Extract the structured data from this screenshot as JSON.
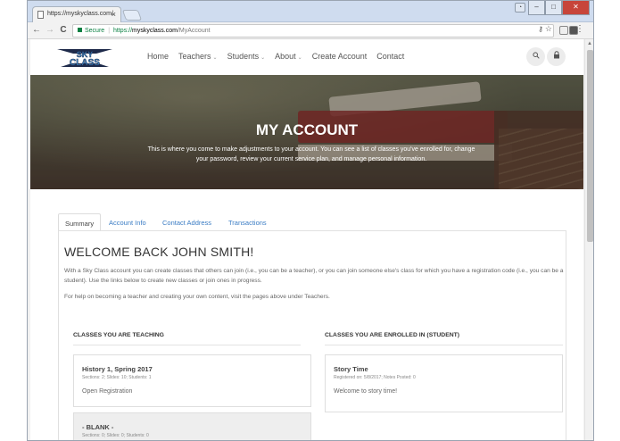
{
  "browser": {
    "tab_title": "https://myskyclass.com/",
    "tab_close": "×",
    "secure_label": "Secure",
    "url_scheme": "https://",
    "url_host": "myskyclass.com",
    "url_path": "/MyAccount",
    "back": "←",
    "forward": "→",
    "reload": "C",
    "home": "⌂",
    "star": "☆",
    "key": "♀",
    "menu": "⋮",
    "minimize": "–",
    "maximize": "□",
    "close": "✕"
  },
  "site": {
    "logo_top": "SKY",
    "logo_bottom": "CLASS",
    "nav": {
      "home": "Home",
      "teachers": "Teachers",
      "students": "Students",
      "about": "About",
      "create_account": "Create Account",
      "contact": "Contact",
      "caret": "⌄"
    }
  },
  "hero": {
    "title": "MY ACCOUNT",
    "description": "This is where you come to make adjustments to your account. You can see a list of classes you've enrolled for, change your password, review your current service plan, and manage personal information."
  },
  "tabs": [
    "Summary",
    "Account Info",
    "Contact Address",
    "Transactions"
  ],
  "summary": {
    "welcome": "WELCOME BACK JOHN SMITH!",
    "intro": "With a Sky Class account you can create classes that others can join (i.e., you can be a teacher), or you can join someone else's class for which you have a registration code (i.e., you can be a student). Use the links below to create new classes or join ones in progress.",
    "help": "For help on becoming a teacher and creating your own content, visit the pages above under Teachers.",
    "teaching_heading": "CLASSES YOU ARE TEACHING",
    "enrolled_heading": "CLASSES YOU ARE ENROLLED IN (STUDENT)",
    "teaching": [
      {
        "title": "History 1, Spring 2017",
        "meta": "Sections: 2; Slides: 10; Students: 1",
        "desc": "Open Registration"
      },
      {
        "title": "- BLANK -",
        "meta": "Sections: 0; Slides: 0; Students: 0",
        "desc": ""
      }
    ],
    "enrolled": [
      {
        "title": "Story Time",
        "meta": "Registered on: 5/8/2017; Notes Posted: 0",
        "desc": "Welcome to story time!"
      }
    ]
  },
  "colors": {
    "link": "#3a7cc4",
    "secure_green": "#0b8043",
    "logo_blue": "#3f8fd0",
    "logo_dark": "#1e2a4a"
  }
}
